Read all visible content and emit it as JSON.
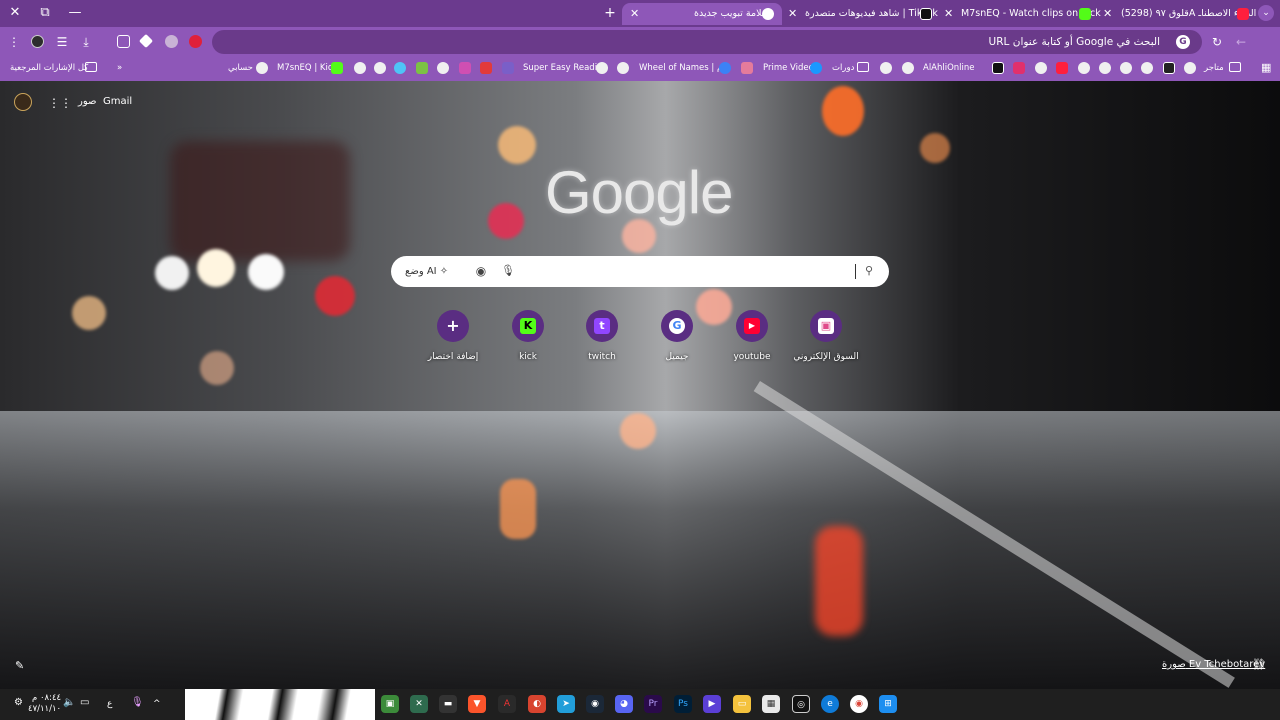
{
  "colors": {
    "titlebar": "#6b3a8e",
    "toolbar": "#8e57b8",
    "omnibox": "#6a3a8a",
    "shortcut_circle": "#5a2d82",
    "taskbar": "#1f1f1f"
  },
  "window": {
    "close": "✕",
    "restore": "⧉",
    "minimize": "—"
  },
  "tabs": [
    {
      "title": "(5298) قلوق ٩٧A الذكاء الاصطناـ",
      "favicon": "youtube-icon"
    },
    {
      "title": "M7snEQ - Watch clips on Kick",
      "favicon": "kick-icon"
    },
    {
      "title": "شاهد فيديوهات متصدرة | TikTok",
      "favicon": "tiktok-icon"
    },
    {
      "title": "علامة تبويب جديدة",
      "favicon": "chrome-icon",
      "active": true
    }
  ],
  "tab_close": "✕",
  "new_tab": "+",
  "tab_search": "⌄",
  "toolbar": {
    "omnibox_placeholder": "البحث في Google أو كتابة عنوان URL",
    "omnibox_g": "G",
    "back": "←",
    "reload": "↻",
    "menu": "⋮",
    "downloads": "⤓",
    "reading_list": "☰"
  },
  "bookmarks": {
    "all_bookmarks": "كل الإشارات المرجعية",
    "overflow": "»",
    "items": [
      {
        "label": "حسابي",
        "icon": "google-icon"
      },
      {
        "label": "M7snEQ | Kick",
        "icon": "kick-icon"
      },
      {
        "label": "Super Easy Reading",
        "icon": "web-icon"
      },
      {
        "label": "Wheel of Names | م...",
        "icon": "wheel-icon"
      },
      {
        "label": "Prime Video",
        "icon": "prime-video-icon"
      },
      {
        "label": "دورات",
        "icon": "folder-icon"
      },
      {
        "label": "AlAhliOnline",
        "icon": "bank-icon"
      },
      {
        "label": "متاجر",
        "icon": "folder-icon"
      }
    ]
  },
  "ntp": {
    "gmail": "Gmail",
    "images": "صور",
    "apps": "⋮⋮⋮",
    "logo": "Google",
    "ai_mode": "وضع AI",
    "search_icon": "⚲",
    "mic": "🎙",
    "lens": "◉",
    "shortcuts": [
      {
        "label": "إضافة اختصار",
        "icon": "+",
        "name": "add-shortcut"
      },
      {
        "label": "kick",
        "icon": "K",
        "name": "kick"
      },
      {
        "label": "twitch",
        "icon": "t",
        "name": "twitch"
      },
      {
        "label": "جيميل",
        "icon": "G",
        "name": "google"
      },
      {
        "label": "youtube",
        "icon": "▶",
        "name": "youtube"
      },
      {
        "label": "السوق الإلكتروني",
        "icon": "▣",
        "name": "store"
      }
    ],
    "photo_credit": "صورة Ev Tchebotarev",
    "link_icon": "⛓",
    "edit_icon": "✎"
  },
  "taskbar": {
    "time": "٠٨:٤٤ م",
    "date": "٤٧/١١/١٠",
    "lang": "ع",
    "chevron": "^"
  }
}
